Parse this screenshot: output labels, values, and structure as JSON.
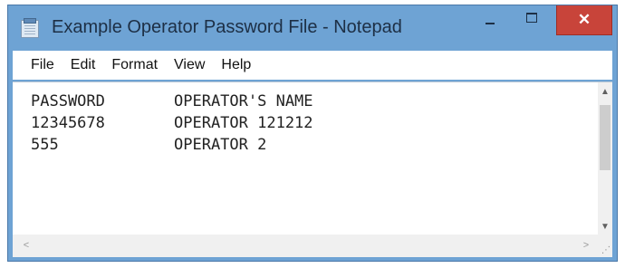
{
  "window": {
    "title": "Example Operator Password File - Notepad",
    "app_icon": "notepad-icon",
    "controls": {
      "minimize_icon": "minimize-icon",
      "maximize_icon": "maximize-icon",
      "close_glyph": "✕"
    }
  },
  "menu": [
    "File",
    "Edit",
    "Format",
    "View",
    "Help"
  ],
  "document": {
    "lines": [
      [
        "PASSWORD",
        "OPERATOR'S NAME"
      ],
      [
        "12345678",
        "OPERATOR 121212"
      ],
      [
        "555",
        "OPERATOR 2"
      ]
    ]
  },
  "scrollbars": {
    "up_glyph": "▲",
    "down_glyph": "▼",
    "left_glyph": "<",
    "right_glyph": ">"
  },
  "colors": {
    "title_bar": "#6ea3d4",
    "close_button": "#c8443a"
  }
}
